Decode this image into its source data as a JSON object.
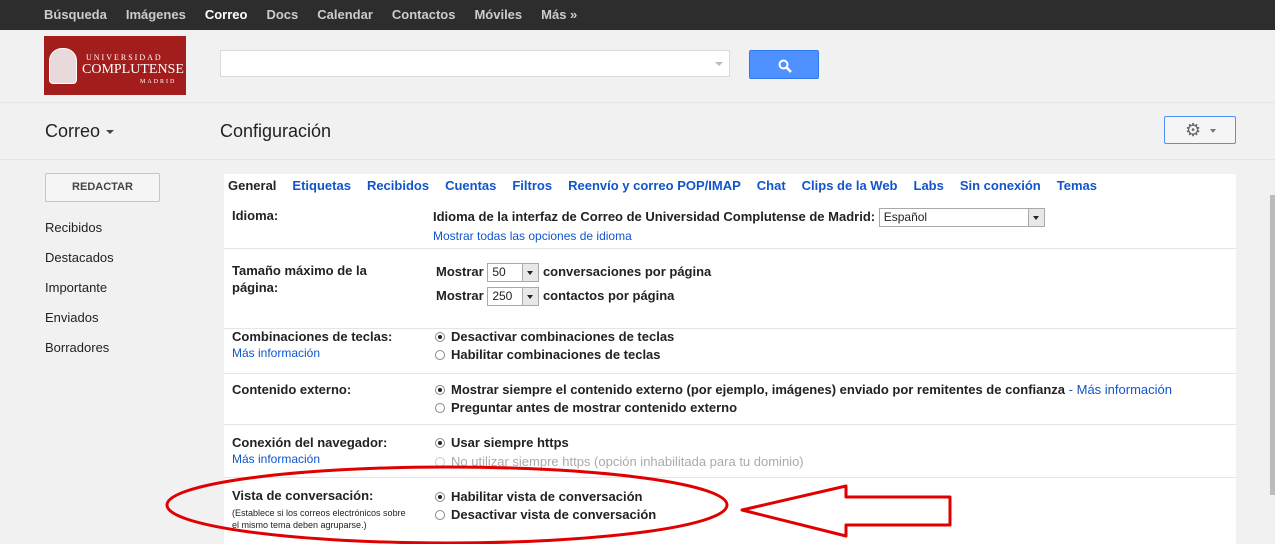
{
  "topnav": [
    "Búsqueda",
    "Imágenes",
    "Correo",
    "Docs",
    "Calendar",
    "Contactos",
    "Móviles",
    "Más »"
  ],
  "logo": {
    "line1": "UNIVERSIDAD",
    "line2": "COMPLUTENSE",
    "line3": "MADRID"
  },
  "search": {
    "placeholder": ""
  },
  "app_label": "Correo",
  "page_title": "Configuración",
  "compose_label": "REDACTAR",
  "folders": [
    "Recibidos",
    "Destacados",
    "Importante",
    "Enviados",
    "Borradores"
  ],
  "tabs": [
    "General",
    "Etiquetas",
    "Recibidos",
    "Cuentas",
    "Filtros",
    "Reenvío y correo POP/IMAP",
    "Chat",
    "Clips de la Web",
    "Labs",
    "Sin conexión",
    "Temas"
  ],
  "settings": {
    "language": {
      "label": "Idioma:",
      "desc": "Idioma de la interfaz de Correo de Universidad Complutense de Madrid:",
      "value": "Español",
      "link": "Mostrar todas las opciones de idioma"
    },
    "page_size": {
      "label_line1": "Tamaño máximo de la",
      "label_line2": "página:",
      "show": "Mostrar",
      "conv_value": "50",
      "conv_text": "conversaciones por página",
      "contact_value": "250",
      "contact_text": "contactos por página"
    },
    "shortcuts": {
      "label": "Combinaciones de teclas:",
      "help": "Más información",
      "opt1": "Desactivar combinaciones de teclas",
      "opt2": "Habilitar combinaciones de teclas"
    },
    "external": {
      "label": "Contenido externo:",
      "opt1": "Mostrar siempre el contenido externo (por ejemplo, imágenes) enviado por remitentes de confianza",
      "opt1_sep": " - ",
      "opt1_link": "Más información",
      "opt2": "Preguntar antes de mostrar contenido externo"
    },
    "browser": {
      "label": "Conexión del navegador:",
      "help": "Más información",
      "opt1": "Usar siempre https",
      "opt2": "No utilizar siempre https (opción inhabilitada para tu dominio)"
    },
    "conversation": {
      "label": "Vista de conversación:",
      "note_line1": "(Establece si los correos electrónicos sobre",
      "note_line2": "el mismo tema deben agruparse.)",
      "opt1": "Habilitar vista de conversación",
      "opt2": "Desactivar vista de conversación"
    }
  },
  "colors": {
    "link": "#1155cc",
    "search_button": "#4d90fe",
    "annotation": "#e00000",
    "logo_bg": "#a41d1d"
  },
  "icons": [
    "search-icon",
    "gear-icon",
    "chevron-down-icon"
  ]
}
